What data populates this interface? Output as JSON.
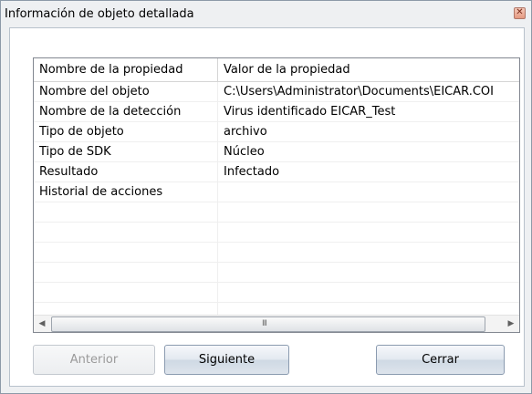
{
  "window": {
    "title": "Información de objeto detallada",
    "close_glyph": "✕"
  },
  "table": {
    "columns": [
      "Nombre de la propiedad",
      "Valor de la propiedad"
    ],
    "rows": [
      {
        "name": "Nombre del objeto",
        "value": "C:\\Users\\Administrator\\Documents\\EICAR.COI"
      },
      {
        "name": "Nombre de la detección",
        "value": "Virus identificado EICAR_Test"
      },
      {
        "name": "Tipo de objeto",
        "value": "archivo"
      },
      {
        "name": "Tipo de SDK",
        "value": "Núcleo"
      },
      {
        "name": "Resultado",
        "value": "Infectado"
      },
      {
        "name": "Historial de acciones",
        "value": ""
      }
    ],
    "scroll_left_glyph": "◀",
    "scroll_right_glyph": "▶",
    "thumb_grip": "III"
  },
  "buttons": {
    "previous": "Anterior",
    "next": "Siguiente",
    "close": "Cerrar"
  }
}
